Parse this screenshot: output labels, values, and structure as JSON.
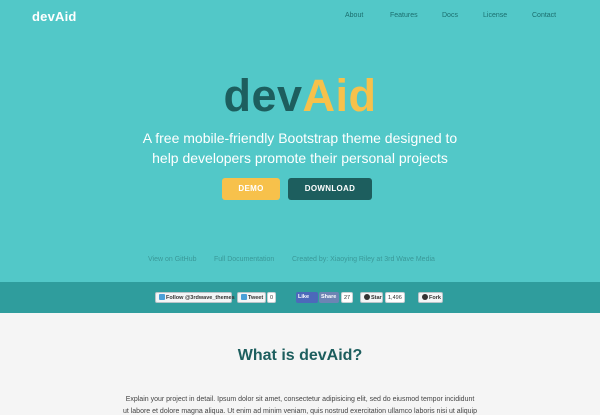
{
  "header": {
    "brand": "devAid",
    "nav": [
      "About",
      "Features",
      "Docs",
      "License",
      "Contact"
    ]
  },
  "hero": {
    "logo_dev": "dev",
    "logo_aid": "Aid",
    "tagline_line1": "A free mobile-friendly Bootstrap theme designed to",
    "tagline_line2": "help developers promote their personal projects",
    "demo_label": "DEMO",
    "download_label": "DOWNLOAD",
    "links": [
      "View on GitHub",
      "Full Documentation",
      "Created by: Xiaoying Riley at 3rd Wave Media"
    ]
  },
  "social": {
    "twitter_follow": "Follow @3rdwave_themes",
    "tweet": "Tweet",
    "tweet_count": "0",
    "fb_like": "Like",
    "fb_share": "Share",
    "fb_count": "27",
    "gh_star": "Star",
    "gh_star_count": "1,496",
    "gh_fork": "Fork"
  },
  "about": {
    "title": "What is devAid?",
    "text_line1": "Explain your project in detail. Ipsum dolor sit amet, consectetur adipisicing elit, sed do eiusmod tempor incididunt",
    "text_line2": "ut labore et dolore magna aliqua. Ut enim ad minim veniam, quis nostrud exercitation ullamco laboris nisi ut aliquip"
  },
  "colors": {
    "hero_bg": "#52c8c8",
    "social_bar_bg": "#2f9d9d",
    "accent_yellow": "#f7c14b",
    "accent_dark": "#1d5e5e"
  }
}
